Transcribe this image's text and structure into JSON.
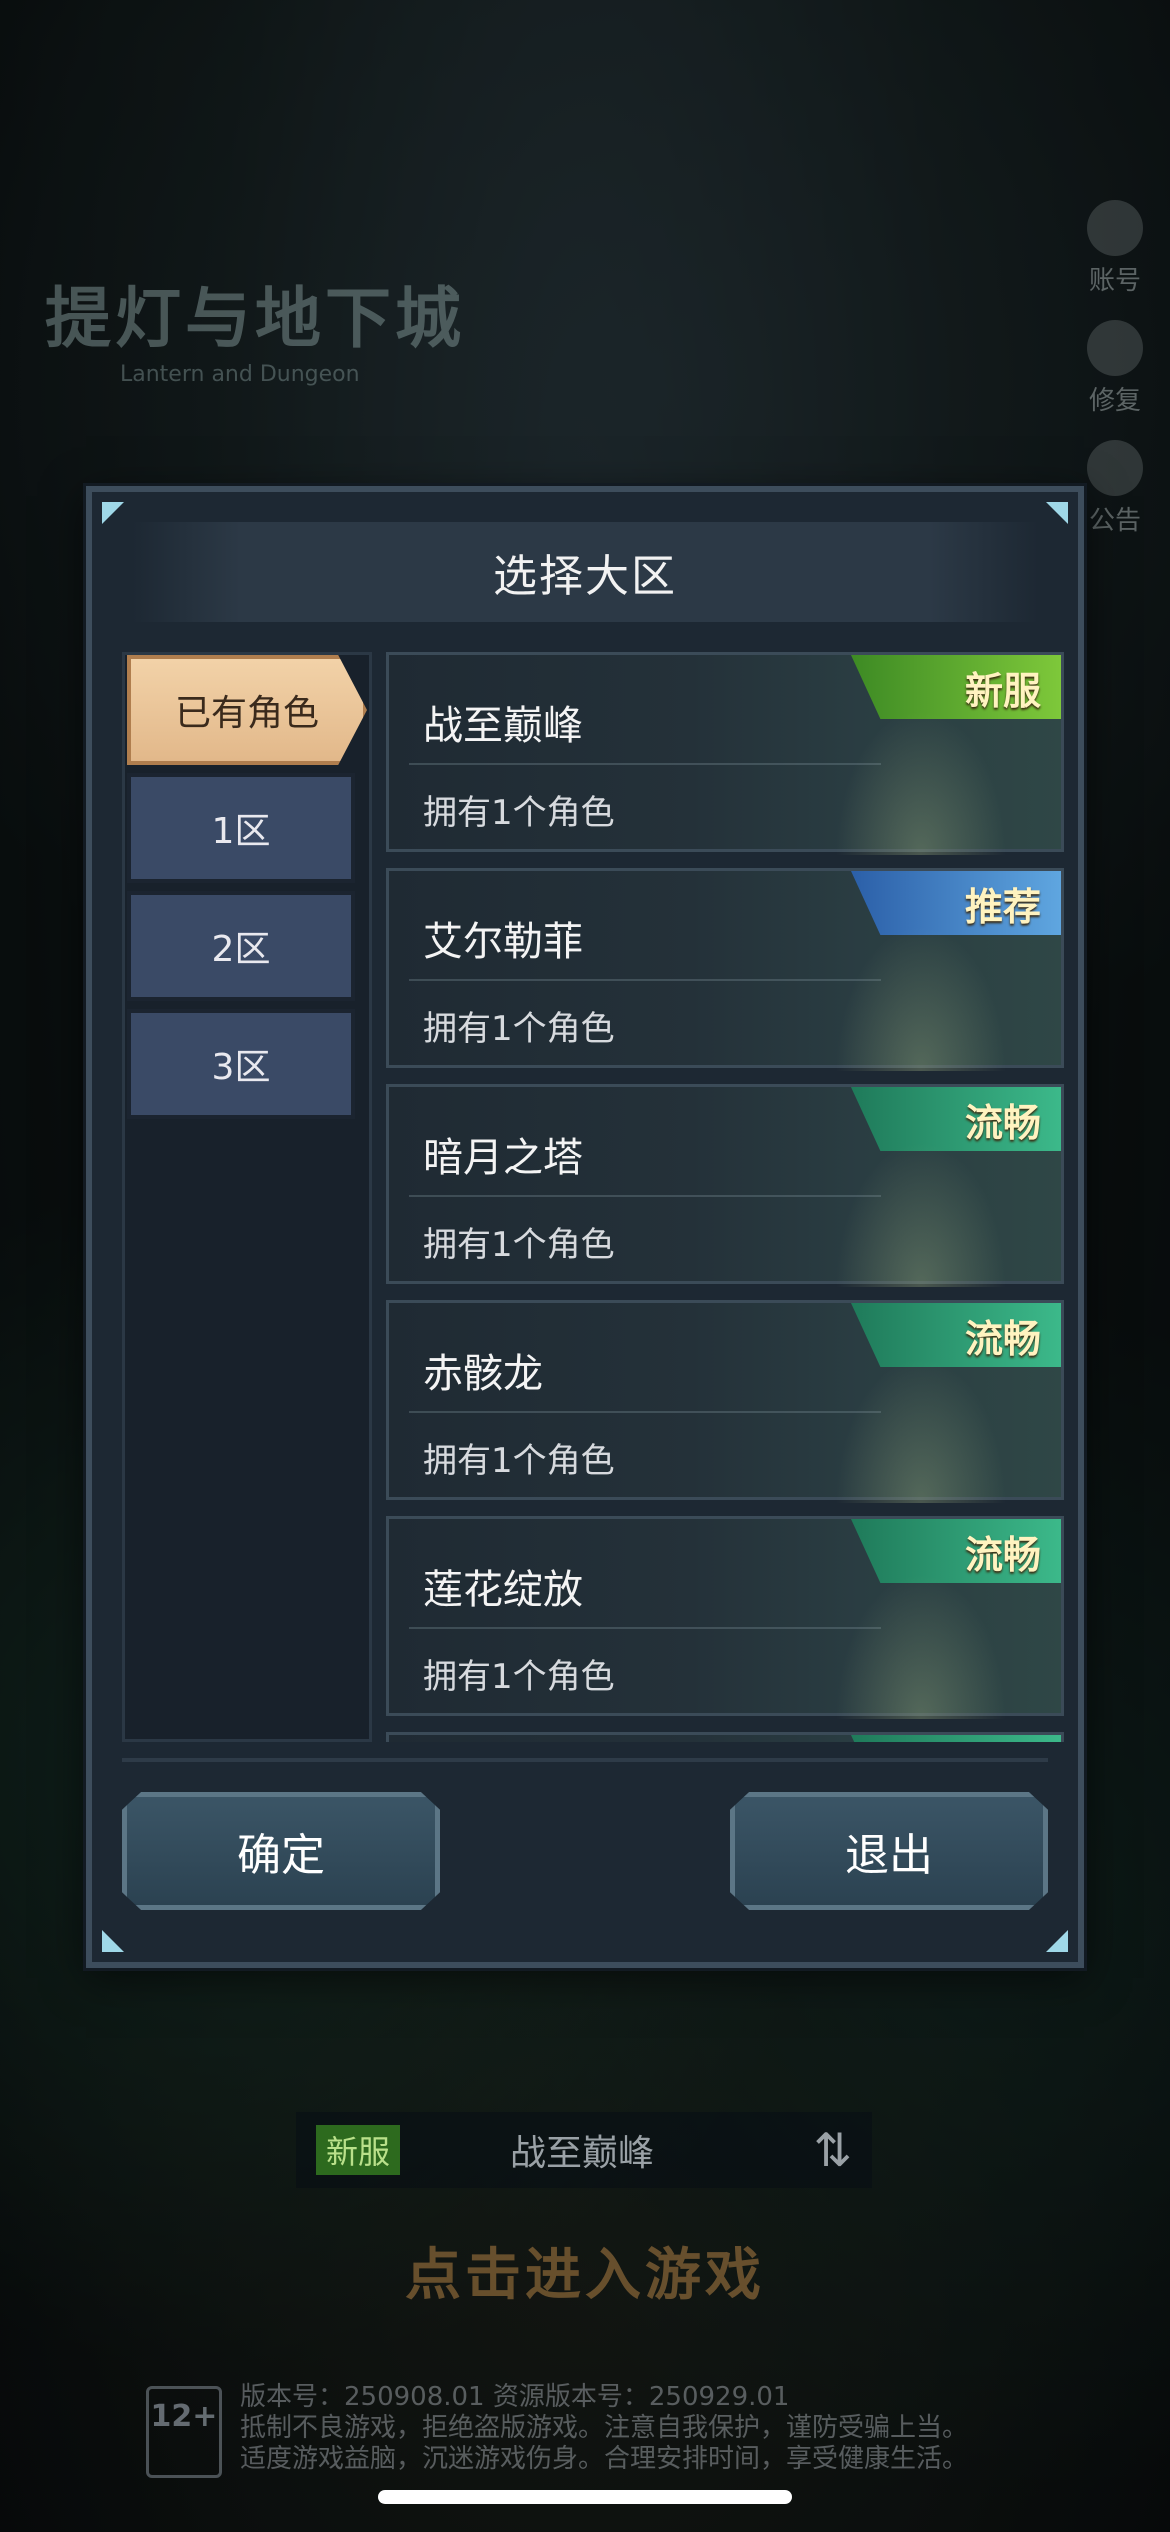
{
  "background": {
    "game_title": "提灯与地下城",
    "game_subtitle": "Lantern and Dungeon",
    "side_buttons": [
      {
        "label": "账号",
        "icon": "account-icon"
      },
      {
        "label": "修复",
        "icon": "wrench-icon"
      },
      {
        "label": "公告",
        "icon": "megaphone-icon"
      }
    ],
    "current_server": {
      "badge": "新服",
      "name": "战至巅峰",
      "swap_icon": "⇅"
    },
    "enter_game": "点击进入游戏",
    "age_rating": "12+",
    "footer_lines": [
      "版本号：250908.01  资源版本号：250929.01",
      "抵制不良游戏，拒绝盗版游戏。注意自我保护，谨防受骗上当。",
      "适度游戏益脑，沉迷游戏伤身。合理安排时间，享受健康生活。"
    ]
  },
  "dialog": {
    "title": "选择大区",
    "tabs": [
      {
        "label": "已有角色",
        "active": true
      },
      {
        "label": "1区",
        "active": false
      },
      {
        "label": "2区",
        "active": false
      },
      {
        "label": "3区",
        "active": false
      }
    ],
    "servers": [
      {
        "name": "战至巅峰",
        "sub": "拥有1个角色",
        "badge": "新服"
      },
      {
        "name": "艾尔勒菲",
        "sub": "拥有1个角色",
        "badge": "推荐"
      },
      {
        "name": "暗月之塔",
        "sub": "拥有1个角色",
        "badge": "流畅"
      },
      {
        "name": "赤骸龙",
        "sub": "拥有1个角色",
        "badge": "流畅"
      },
      {
        "name": "莲花绽放",
        "sub": "拥有1个角色",
        "badge": "流畅"
      }
    ],
    "confirm_label": "确定",
    "exit_label": "退出"
  }
}
